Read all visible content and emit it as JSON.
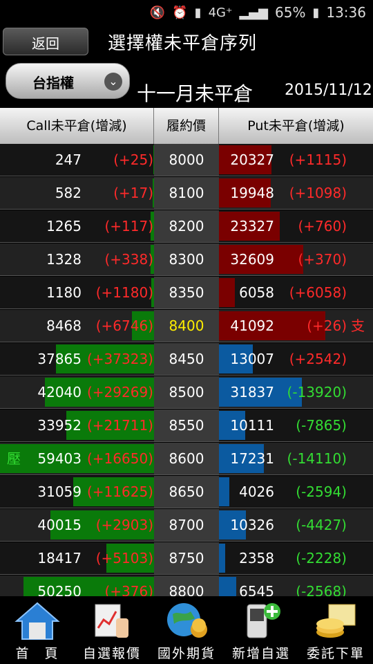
{
  "status_bar": {
    "signal": "4G⁺",
    "battery": "65%",
    "time": "13:36"
  },
  "header": {
    "back_label": "返回",
    "title": "選擇權未平倉序列"
  },
  "filter": {
    "selected": "台指權",
    "month_title": "十一月未平倉",
    "date": "2015/11/12"
  },
  "columns": {
    "call": "Call未平倉(增減)",
    "strike": "履約價",
    "put": "Put未平倉(增減)"
  },
  "marks": {
    "pressure": "壓",
    "support": "支"
  },
  "colors": {
    "call_bar": "#0a7a0a",
    "put_bar_neg": "#7a0000",
    "put_bar_pos": "#0b5aa0",
    "positive": "#ff2a2a",
    "negative": "#33dd33",
    "highlight_strike": "#ffee00"
  },
  "max_oi": 59403,
  "rows": [
    {
      "strike": "8000",
      "call": "247",
      "call_chg": "(+25)",
      "put": "20327",
      "put_chg": "(+1115)"
    },
    {
      "strike": "8100",
      "call": "582",
      "call_chg": "(+17)",
      "put": "19948",
      "put_chg": "(+1098)"
    },
    {
      "strike": "8200",
      "call": "1265",
      "call_chg": "(+117)",
      "put": "23327",
      "put_chg": "(+760)"
    },
    {
      "strike": "8300",
      "call": "1328",
      "call_chg": "(+338)",
      "put": "32609",
      "put_chg": "(+370)"
    },
    {
      "strike": "8350",
      "call": "1180",
      "call_chg": "(+1180)",
      "put": "6058",
      "put_chg": "(+6058)"
    },
    {
      "strike": "8400",
      "call": "8468",
      "call_chg": "(+6746)",
      "put": "41092",
      "put_chg": "(+26)",
      "highlight": true
    },
    {
      "strike": "8450",
      "call": "37865",
      "call_chg": "(+37323)",
      "put": "13007",
      "put_chg": "(+2542)"
    },
    {
      "strike": "8500",
      "call": "42040",
      "call_chg": "(+29269)",
      "put": "31837",
      "put_chg": "(-13920)"
    },
    {
      "strike": "8550",
      "call": "33952",
      "call_chg": "(+21711)",
      "put": "10111",
      "put_chg": "(-7865)"
    },
    {
      "strike": "8600",
      "call": "59403",
      "call_chg": "(+16650)",
      "put": "17231",
      "put_chg": "(-14110)"
    },
    {
      "strike": "8650",
      "call": "31059",
      "call_chg": "(+11625)",
      "put": "4026",
      "put_chg": "(-2594)"
    },
    {
      "strike": "8700",
      "call": "40015",
      "call_chg": "(+2903)",
      "put": "10326",
      "put_chg": "(-4427)"
    },
    {
      "strike": "8750",
      "call": "18417",
      "call_chg": "(+5103)",
      "put": "2358",
      "put_chg": "(-2228)"
    },
    {
      "strike": "8800",
      "call": "50250",
      "call_chg": "(+376)",
      "put": "6545",
      "put_chg": "(-2568)"
    }
  ],
  "nav": [
    {
      "label": "首　頁",
      "icon": "home-icon"
    },
    {
      "label": "自選報價",
      "icon": "watchlist-icon"
    },
    {
      "label": "國外期貨",
      "icon": "globe-icon"
    },
    {
      "label": "新增自選",
      "icon": "add-phone-icon"
    },
    {
      "label": "委託下單",
      "icon": "order-icon"
    }
  ]
}
